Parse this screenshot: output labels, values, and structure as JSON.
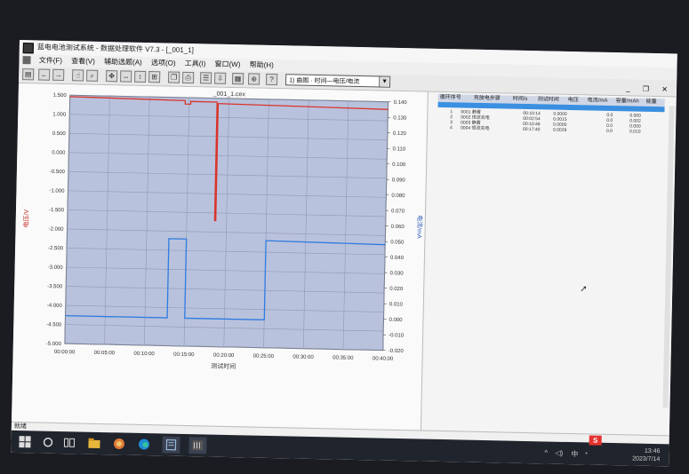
{
  "window": {
    "title": "蓝电电池测试系统 - 数据处理软件 V7.3 - [_001_1]",
    "icon": "app-icon"
  },
  "menu": [
    "文件(F)",
    "查看(V)",
    "辅助选题(A)",
    "选项(O)",
    "工具(I)",
    "窗口(W)",
    "帮助(H)"
  ],
  "toolbar": {
    "view_select": "1) 曲图 · 时间—电压/电流",
    "icons": [
      "open-icon",
      "back-icon",
      "forward-icon",
      "hand-icon",
      "zoom-icon",
      "pan-icon",
      "fit-x-icon",
      "fit-y-icon",
      "fit-all-icon",
      "copy-icon",
      "print-icon",
      "list-icon",
      "export-icon",
      "grid-icon",
      "zoom-in-icon",
      "info-icon"
    ]
  },
  "status_bar": "就绪",
  "chart_data": {
    "type": "line",
    "title": "_001_1.cex",
    "xlabel": "测试时间",
    "ylabel_left": "电压/V",
    "ylabel_right": "电流/mA",
    "x_ticks": [
      "00:00:00",
      "00:05:00",
      "00:10:00",
      "00:15:00",
      "00:20:00",
      "00:25:00",
      "00:30:00",
      "00:35:00",
      "00:40:00"
    ],
    "xlim_minutes": [
      0,
      40
    ],
    "y_left_ticks": [
      "1.500",
      "1.000",
      "0.500",
      "0.000",
      "-0.500",
      "-1.000",
      "-1.500",
      "-2.000",
      "-2.500",
      "-3.000",
      "-3.500",
      "-4.000",
      "-4.500",
      "-5.000"
    ],
    "ylim_left": [
      -5.0,
      1.5
    ],
    "y_right_ticks": [
      "0.140",
      "0.130",
      "0.120",
      "0.110",
      "0.100",
      "0.090",
      "0.080",
      "0.070",
      "0.060",
      "0.050",
      "0.040",
      "0.030",
      "0.020",
      "0.010",
      "0.000",
      "-0.010",
      "-0.020"
    ],
    "ylim_right": [
      -0.02,
      0.14
    ],
    "grid": true,
    "series": [
      {
        "color": "#d9342b",
        "axis": "left",
        "x": [
          0,
          14.5,
          14.5,
          15.2,
          15.2,
          18.5,
          18.5,
          18.65,
          18.65,
          18.8,
          18.8,
          40
        ],
        "y": [
          1.46,
          1.42,
          1.33,
          1.33,
          1.4,
          1.4,
          -1.7,
          -1.7,
          1.36,
          1.36,
          1.36,
          1.3
        ]
      },
      {
        "color": "#2d7be0",
        "axis": "right",
        "x": [
          0,
          12.8,
          12.8,
          15.0,
          15.0,
          25.0,
          25.0,
          40
        ],
        "y": [
          -0.002,
          -0.002,
          0.049,
          0.049,
          -0.002,
          -0.002,
          0.049,
          0.048
        ]
      }
    ]
  },
  "step_table": {
    "columns": [
      "循环序号",
      "充放电步骤",
      "时间/s",
      "测试时间",
      "电压",
      "电流/mA",
      "容量/mAh",
      "能量"
    ],
    "rows": [
      [
        "1",
        "0001 静置",
        "00:10:14",
        "0.0000",
        "0.0",
        "0.000"
      ],
      [
        "2",
        "0002 恒流充电",
        "00:02:54",
        "0.0015",
        "0.0",
        "0.002"
      ],
      [
        "3",
        "0003 静置",
        "00:10:46",
        "0.0000",
        "0.0",
        "0.000"
      ],
      [
        "4",
        "0004 恒流充电",
        "00:17:40",
        "0.0029",
        "0.0",
        "0.010"
      ]
    ]
  },
  "taskbar": {
    "apps": [
      "start-icon",
      "search-icon",
      "taskview-icon",
      "explorer-icon",
      "browser-icon",
      "edge-icon",
      "app-window-icon",
      "terminal-icon"
    ],
    "tray_text": "中",
    "ime": "S",
    "time": "13:46",
    "date": "2023/7/14"
  }
}
